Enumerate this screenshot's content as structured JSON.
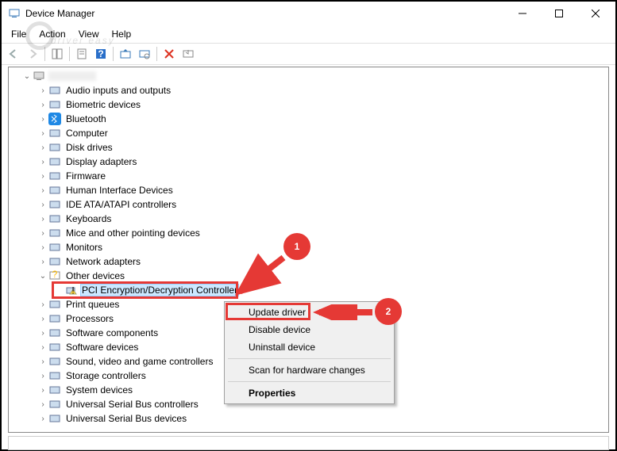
{
  "window": {
    "title": "Device Manager"
  },
  "menu": {
    "file": "File",
    "action": "Action",
    "view": "View",
    "help": "Help"
  },
  "watermark": "driver easy",
  "tree": {
    "root": "",
    "items": [
      "Audio inputs and outputs",
      "Biometric devices",
      "Bluetooth",
      "Computer",
      "Disk drives",
      "Display adapters",
      "Firmware",
      "Human Interface Devices",
      "IDE ATA/ATAPI controllers",
      "Keyboards",
      "Mice and other pointing devices",
      "Monitors",
      "Network adapters",
      "Other devices",
      "Print queues",
      "Processors",
      "Software components",
      "Software devices",
      "Sound, video and game controllers",
      "Storage controllers",
      "System devices",
      "Universal Serial Bus controllers",
      "Universal Serial Bus devices"
    ],
    "selected_child": "PCI Encryption/Decryption Controller"
  },
  "context_menu": {
    "update": "Update driver",
    "disable": "Disable device",
    "uninstall": "Uninstall device",
    "scan": "Scan for hardware changes",
    "properties": "Properties"
  },
  "annotations": {
    "step1": "1",
    "step2": "2"
  }
}
